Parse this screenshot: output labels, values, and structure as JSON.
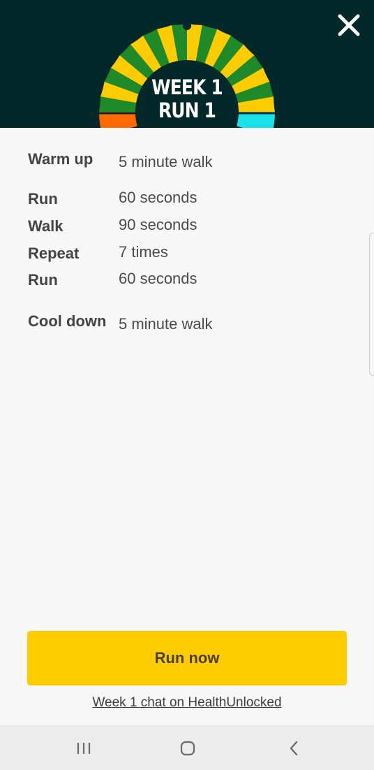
{
  "header": {
    "badge_line1": "WEEK 1",
    "badge_line2": "RUN 1",
    "close_icon": "close-icon",
    "colors": {
      "background": "#03282a",
      "green": "#1e8a2a",
      "yellow": "#ffcc00",
      "orange": "#ff6a00",
      "cyan": "#19e2ea"
    }
  },
  "plan": {
    "warm_up": {
      "label": "Warm up",
      "value": "5 minute walk"
    },
    "steps": [
      {
        "label": "Run",
        "value": "60 seconds"
      },
      {
        "label": "Walk",
        "value": "90 seconds"
      },
      {
        "label": "Repeat",
        "value": "7 times"
      },
      {
        "label": "Run",
        "value": "60 seconds"
      }
    ],
    "cool_down": {
      "label": "Cool down",
      "value": "5 minute walk"
    }
  },
  "actions": {
    "run_now": "Run now",
    "chat_link": "Week 1 chat on HealthUnlocked",
    "accent_color": "#ffcc00"
  },
  "navbar": {
    "recent_icon": "recent-apps-icon",
    "home_icon": "home-icon",
    "back_icon": "back-icon"
  }
}
